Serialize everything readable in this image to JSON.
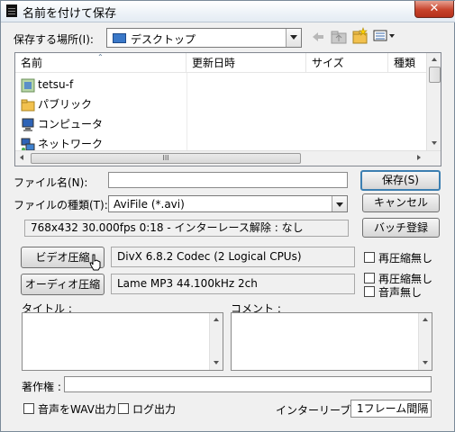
{
  "window": {
    "title": "名前を付けて保存",
    "close_glyph": "✕"
  },
  "location": {
    "label": "保存する場所(I):",
    "value": "デスクトップ",
    "toolbar_icons": [
      "back-arrow-icon",
      "up-folder-icon",
      "new-folder-icon",
      "view-menu-icon"
    ]
  },
  "file_list": {
    "columns": [
      "名前",
      "更新日時",
      "サイズ",
      "種類"
    ],
    "items": [
      {
        "name": "tetsu-f",
        "icon": "user-folder-icon"
      },
      {
        "name": "パブリック",
        "icon": "folder-icon"
      },
      {
        "name": "コンピュータ",
        "icon": "computer-icon"
      },
      {
        "name": "ネットワーク",
        "icon": "network-icon"
      }
    ],
    "hscroll_glyph": "III"
  },
  "filename": {
    "label": "ファイル名(N):",
    "value": ""
  },
  "filetype": {
    "label": "ファイルの種類(T):",
    "value": "AviFile (*.avi)"
  },
  "info_line": "768x432  30.000fps  0:18  -  インターレース解除 : なし",
  "buttons": {
    "save": "保存(S)",
    "cancel": "キャンセル",
    "batch": "バッチ登録"
  },
  "video": {
    "button": "ビデオ圧縮",
    "codec": "DivX  6.8.2 Codec (2 Logical CPUs)",
    "recompress_label": "再圧縮無し"
  },
  "audio": {
    "button": "オーディオ圧縮",
    "codec": "Lame MP3 44.100kHz 2ch",
    "recompress_label": "再圧縮無し",
    "no_audio_label": "音声無し"
  },
  "title_field": {
    "label": "タイトル :"
  },
  "comment_field": {
    "label": "コメント :"
  },
  "copyright": {
    "label": "著作権 :",
    "value": ""
  },
  "footer": {
    "wav_label": "音声をWAV出力",
    "log_label": "ログ出力",
    "interleave_label": "インターリーブ :",
    "interleave_value": "1フレーム間隔"
  },
  "colors": {
    "selection_blue": "#3c7fb1",
    "close_red": "#c7432b"
  }
}
